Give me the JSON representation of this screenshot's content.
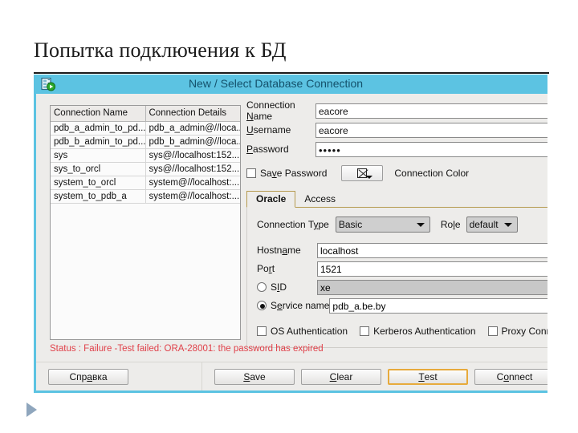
{
  "slide": {
    "title": "Попытка подключения к БД",
    "play_icon": "play-triangle-icon"
  },
  "dialog": {
    "title": "New / Select Database Connection",
    "icon": "database-connection-icon",
    "titlebar_color": "#5cc3e2",
    "accent_color": "#5cc3e2"
  },
  "connection_list": {
    "columns": [
      "Connection Name",
      "Connection Details"
    ],
    "rows": [
      {
        "name": "pdb_a_admin_to_pd...",
        "details": "pdb_a_admin@//loca..."
      },
      {
        "name": "pdb_b_admin_to_pd...",
        "details": "pdb_b_admin@//loca..."
      },
      {
        "name": "sys",
        "details": "sys@//localhost:152..."
      },
      {
        "name": "sys_to_orcl",
        "details": "sys@//localhost:152..."
      },
      {
        "name": "system_to_orcl",
        "details": "system@//localhost:..."
      },
      {
        "name": "system_to_pdb_a",
        "details": "system@//localhost:..."
      }
    ]
  },
  "form": {
    "connection_name_label": "Connection Name",
    "connection_name_value": "eacore",
    "username_label": "Username",
    "username_value": "eacore",
    "password_label": "Password",
    "password_value": "•••••",
    "save_password_label": "Save Password",
    "save_password_checked": false,
    "connection_color_label": "Connection Color",
    "connection_color_value": "none",
    "connection_color_icon": "no-color-swatch-icon"
  },
  "tabs": [
    {
      "label": "Oracle",
      "active": true
    },
    {
      "label": "Access",
      "active": false
    }
  ],
  "oracle_tab": {
    "connection_type_label": "Connection Type",
    "connection_type_value": "Basic",
    "role_label": "Role",
    "role_value": "default",
    "hostname_label": "Hostname",
    "hostname_value": "localhost",
    "port_label": "Port",
    "port_value": "1521",
    "sid_label": "SID",
    "sid_value": "xe",
    "sid_selected": false,
    "service_name_label": "Service name",
    "service_name_value": "pdb_a.be.by",
    "service_name_selected": true,
    "os_authentication_label": "OS Authentication",
    "os_authentication_checked": false,
    "kerberos_authentication_label": "Kerberos Authentication",
    "kerberos_authentication_checked": false,
    "proxy_connection_label": "Proxy Connection",
    "proxy_connection_checked": false
  },
  "status": {
    "text": "Status : Failure -Test failed: ORA-28001: the password has expired",
    "color": "#e0414a"
  },
  "buttons": {
    "help": "Справка",
    "save": "Save",
    "clear": "Clear",
    "test": "Test",
    "connect": "Connect",
    "focused": "Test"
  }
}
